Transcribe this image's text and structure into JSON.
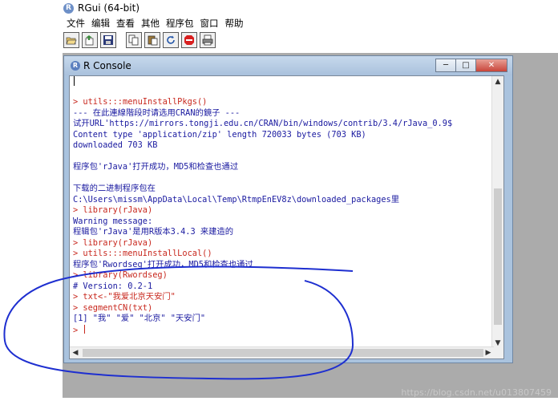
{
  "app": {
    "title": "RGui (64-bit)",
    "icon": "r-logo-icon"
  },
  "menu": [
    "文件",
    "编辑",
    "查看",
    "其他",
    "程序包",
    "窗口",
    "帮助"
  ],
  "toolbar": [
    "open-script-icon",
    "load-workspace-icon",
    "save-icon",
    "copy-icon",
    "paste-icon",
    "refresh-icon",
    "stop-icon",
    "print-icon"
  ],
  "console": {
    "title": "R Console",
    "lines": [
      {
        "t": "> utils:::menuInstallPkgs()",
        "k": "cmd"
      },
      {
        "t": "--- 在此連線階段时请选用CRAN的鏡子 ---",
        "k": "out"
      },
      {
        "t": "试开URL'https://mirrors.tongji.edu.cn/CRAN/bin/windows/contrib/3.4/rJava_0.9$",
        "k": "out"
      },
      {
        "t": "Content type 'application/zip' length 720033 bytes (703 KB)",
        "k": "out"
      },
      {
        "t": "downloaded 703 KB",
        "k": "out"
      },
      {
        "t": "",
        "k": "out"
      },
      {
        "t": "程序包'rJava'打开成功，MD5和检查也通过",
        "k": "out"
      },
      {
        "t": "",
        "k": "out"
      },
      {
        "t": "下载的二进制程序包在",
        "k": "out"
      },
      {
        "t": "        C:\\Users\\missm\\AppData\\Local\\Temp\\RtmpEnEV8z\\downloaded_packages里",
        "k": "out"
      },
      {
        "t": "> library(rJava)",
        "k": "cmd"
      },
      {
        "t": "Warning message:",
        "k": "out"
      },
      {
        "t": "程辑包'rJava'是用R版本3.4.3 来建造的",
        "k": "out"
      },
      {
        "t": "> library(rJava)",
        "k": "cmd"
      },
      {
        "t": "> utils:::menuInstallLocal()",
        "k": "cmd"
      },
      {
        "t": "程序包'Rwordseg'打开成功，MD5和检查也通过",
        "k": "out"
      },
      {
        "t": "> library(Rwordseg)",
        "k": "cmd"
      },
      {
        "t": "# Version: 0.2-1",
        "k": "out"
      },
      {
        "t": "> txt<-\"我爱北京天安门\"",
        "k": "cmd"
      },
      {
        "t": "> segmentCN(txt)",
        "k": "cmd"
      },
      {
        "t": "[1] \"我\"      \"爱\"      \"北京\"    \"天安门\"",
        "k": "out"
      },
      {
        "t": "> ",
        "k": "cmd"
      }
    ]
  },
  "watermark": "https://blog.csdn.net/u013807459",
  "colors": {
    "command": "#c8281e",
    "output": "#1a1aa0",
    "annotation": "#1e2fd0"
  }
}
